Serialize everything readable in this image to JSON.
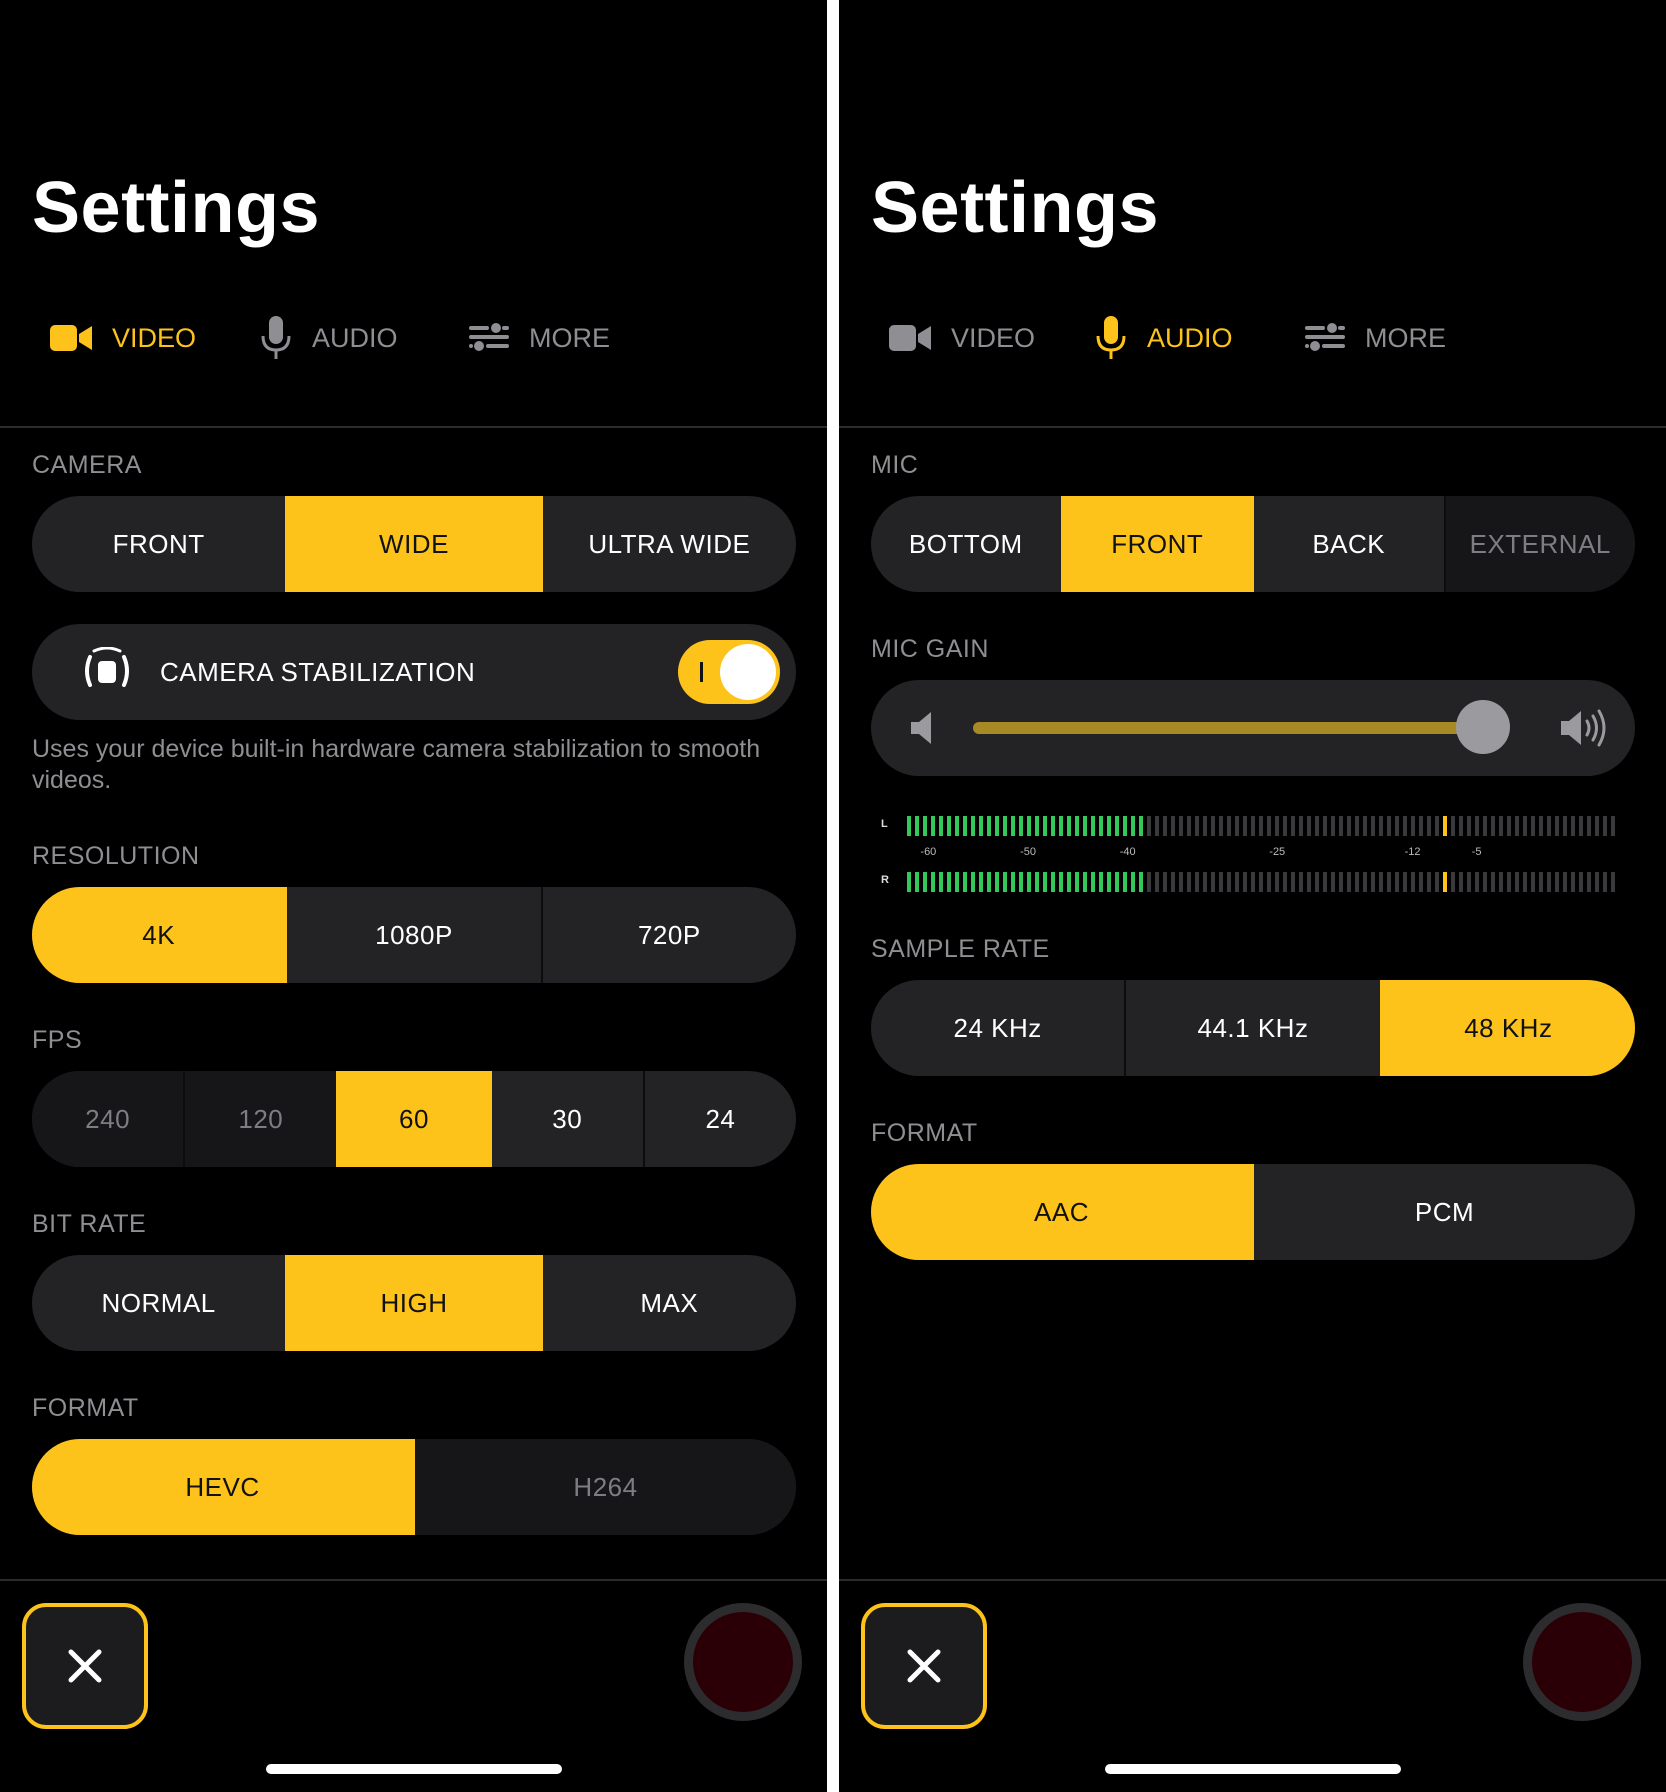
{
  "left": {
    "title": "Settings",
    "tabs": [
      {
        "label": "VIDEO",
        "icon": "video-camera-icon",
        "active": true
      },
      {
        "label": "AUDIO",
        "icon": "microphone-icon",
        "active": false
      },
      {
        "label": "MORE",
        "icon": "sliders-icon",
        "active": false
      }
    ],
    "camera": {
      "label": "CAMERA",
      "options": [
        "FRONT",
        "WIDE",
        "ULTRA WIDE"
      ],
      "selected": "WIDE"
    },
    "stabilization": {
      "label": "CAMERA STABILIZATION",
      "icon": "stabilization-icon",
      "enabled": true,
      "helper": "Uses your device built-in hardware camera stabilization to smooth videos."
    },
    "resolution": {
      "label": "RESOLUTION",
      "options": [
        "4K",
        "1080P",
        "720P"
      ],
      "selected": "4K"
    },
    "fps": {
      "label": "FPS",
      "options": [
        "240",
        "120",
        "60",
        "30",
        "24"
      ],
      "selected": "60",
      "disabled": [
        "240",
        "120"
      ]
    },
    "bit_rate": {
      "label": "BIT RATE",
      "options": [
        "NORMAL",
        "HIGH",
        "MAX"
      ],
      "selected": "HIGH"
    },
    "format": {
      "label": "FORMAT",
      "options": [
        "HEVC",
        "H264"
      ],
      "selected": "HEVC",
      "disabled": [
        "H264"
      ]
    },
    "close_icon": "close-icon",
    "record_icon": "record-icon"
  },
  "right": {
    "title": "Settings",
    "tabs": [
      {
        "label": "VIDEO",
        "icon": "video-camera-icon",
        "active": false
      },
      {
        "label": "AUDIO",
        "icon": "microphone-icon",
        "active": true
      },
      {
        "label": "MORE",
        "icon": "sliders-icon",
        "active": false
      }
    ],
    "mic": {
      "label": "MIC",
      "options": [
        "BOTTOM",
        "FRONT",
        "BACK",
        "EXTERNAL"
      ],
      "selected": "FRONT",
      "disabled": [
        "EXTERNAL"
      ]
    },
    "mic_gain": {
      "label": "MIC GAIN",
      "value": 1.0,
      "icon_low": "volume-low-icon",
      "icon_high": "volume-high-icon"
    },
    "level_meter": {
      "channels": [
        "L",
        "R"
      ],
      "scale": [
        "-60",
        "-50",
        "-40",
        "-25",
        "-12",
        "-5"
      ],
      "level_fraction": 0.34,
      "peak_fraction": 0.75
    },
    "sample_rate": {
      "label": "SAMPLE RATE",
      "options": [
        "24 KHz",
        "44.1 KHz",
        "48 KHz"
      ],
      "selected": "48 KHz"
    },
    "format": {
      "label": "FORMAT",
      "options": [
        "AAC",
        "PCM"
      ],
      "selected": "AAC"
    },
    "close_icon": "close-icon",
    "record_icon": "record-icon"
  },
  "colors": {
    "accent": "#fdc31b",
    "background": "#000000",
    "control": "#232325",
    "muted_text": "#8e8e93",
    "meter_green": "#34c759"
  }
}
